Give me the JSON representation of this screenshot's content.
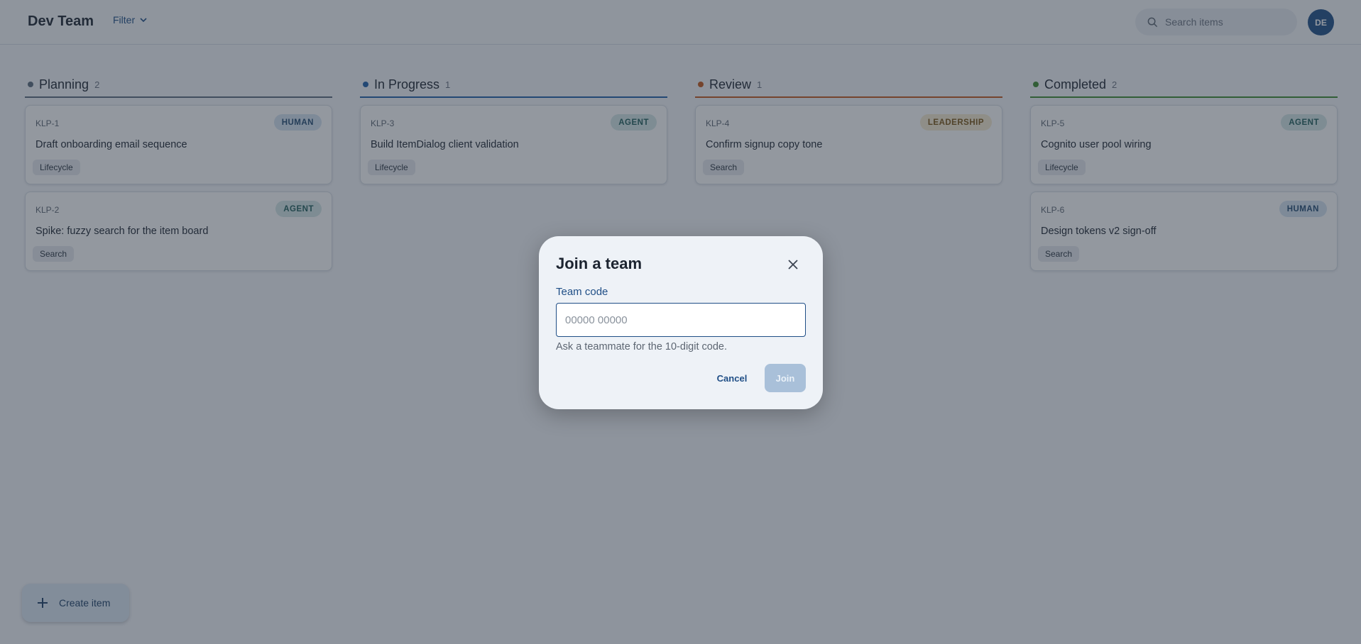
{
  "header": {
    "team_name": "Dev Team",
    "filter_label": "Filter",
    "search_placeholder": "Search items",
    "avatar_initials": "DE"
  },
  "columns": [
    {
      "title": "Planning",
      "count": "2",
      "color": "#5b6b7c",
      "cards": [
        {
          "id": "KLP-1",
          "badge": "HUMAN",
          "badge_kind": "human",
          "title": "Draft onboarding email sequence",
          "tag": "Lifecycle"
        },
        {
          "id": "KLP-2",
          "badge": "AGENT",
          "badge_kind": "agent",
          "title": "Spike: fuzzy search for the item board",
          "tag": "Search"
        }
      ]
    },
    {
      "title": "In Progress",
      "count": "1",
      "color": "#1f5fa8",
      "cards": [
        {
          "id": "KLP-3",
          "badge": "AGENT",
          "badge_kind": "agent",
          "title": "Build ItemDialog client validation",
          "tag": "Lifecycle"
        }
      ]
    },
    {
      "title": "Review",
      "count": "1",
      "color": "#c2571a",
      "cards": [
        {
          "id": "KLP-4",
          "badge": "LEADERSHIP",
          "badge_kind": "leadership",
          "title": "Confirm signup copy tone",
          "tag": "Search"
        }
      ]
    },
    {
      "title": "Completed",
      "count": "2",
      "color": "#3d8a2e",
      "cards": [
        {
          "id": "KLP-5",
          "badge": "AGENT",
          "badge_kind": "agent",
          "title": "Cognito user pool wiring",
          "tag": "Lifecycle"
        },
        {
          "id": "KLP-6",
          "badge": "HUMAN",
          "badge_kind": "human",
          "title": "Design tokens v2 sign-off",
          "tag": "Search"
        }
      ]
    }
  ],
  "create_button_label": "Create item",
  "dialog": {
    "title": "Join a team",
    "field_label": "Team code",
    "input_value": "",
    "input_placeholder": "00000 00000",
    "help_text": "Ask a teammate for the 10-digit code.",
    "cancel_label": "Cancel",
    "join_label": "Join"
  },
  "colors": {
    "accent": "#1f4e86",
    "join_disabled": "#a9c0d9"
  }
}
